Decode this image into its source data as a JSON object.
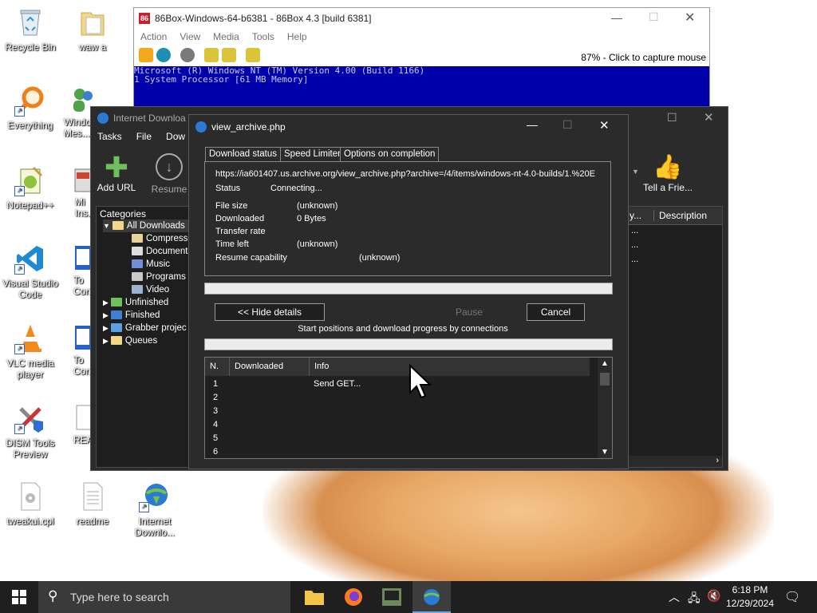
{
  "desktop": {
    "icons": [
      {
        "label": "Recycle Bin"
      },
      {
        "label": "waw a"
      },
      {
        "label": "Everything"
      },
      {
        "label": "Windows Mes..."
      },
      {
        "label": "Notepad++"
      },
      {
        "label": "Mi Ins..."
      },
      {
        "label": "Visual Studio Code"
      },
      {
        "label": "To Comm..."
      },
      {
        "label": "VLC media player"
      },
      {
        "label": "To Comm..."
      },
      {
        "label": "DISM Tools Preview"
      },
      {
        "label": "REA..."
      },
      {
        "label": "tweakui.cpl"
      },
      {
        "label": "readme"
      },
      {
        "label": "Internet Downlo..."
      }
    ]
  },
  "box86": {
    "title": "86Box-Windows-64-b6381 - 86Box 4.3 [build 6381]",
    "menu": [
      "Action",
      "View",
      "Media",
      "Tools",
      "Help"
    ],
    "status": "87% - Click to capture mouse",
    "screen_line1": "Microsoft (R) Windows NT (TM) Version 4.00 (Build 1166)",
    "screen_line2": "1 System Processor [61 MB Memory]"
  },
  "idm": {
    "title": "Internet Downloa",
    "menu": [
      "Tasks",
      "File",
      "Dow"
    ],
    "add_url": "Add URL",
    "resume": "Resume",
    "tell_friend": "Tell a Frie...",
    "categories_header": "Categories",
    "categories": [
      {
        "label": "All Downloads"
      },
      {
        "label": "Compresse"
      },
      {
        "label": "Documents"
      },
      {
        "label": "Music"
      },
      {
        "label": "Programs"
      },
      {
        "label": "Video"
      },
      {
        "label": "Unfinished"
      },
      {
        "label": "Finished"
      },
      {
        "label": "Grabber projec"
      },
      {
        "label": "Queues"
      }
    ],
    "col_partial": "y...",
    "col_description": "Description",
    "row_dots": [
      "...",
      "...",
      "..."
    ]
  },
  "dialog": {
    "title": "view_archive.php",
    "tabs": [
      "Download status",
      "Speed Limiter",
      "Options on completion"
    ],
    "url": "https://ia601407.us.archive.org/view_archive.php?archive=/4/items/windows-nt-4.0-builds/1.%20E",
    "status_label": "Status",
    "status_value": "Connecting...",
    "file_size_label": "File size",
    "file_size_value": "(unknown)",
    "downloaded_label": "Downloaded",
    "downloaded_value": "0 Bytes",
    "transfer_rate_label": "Transfer rate",
    "time_left_label": "Time left",
    "time_left_value": "(unknown)",
    "resume_label": "Resume capability",
    "resume_value": "(unknown)",
    "hide_details": "<< Hide details",
    "pause": "Pause",
    "cancel": "Cancel",
    "connections_caption": "Start positions and download progress by connections",
    "table_headers": [
      "N.",
      "Downloaded",
      "Info"
    ],
    "rows": [
      {
        "n": "1",
        "info": "Send GET..."
      },
      {
        "n": "2",
        "info": ""
      },
      {
        "n": "3",
        "info": ""
      },
      {
        "n": "4",
        "info": ""
      },
      {
        "n": "5",
        "info": ""
      },
      {
        "n": "6",
        "info": ""
      }
    ]
  },
  "taskbar": {
    "search_placeholder": "Type here to search",
    "time": "6:18 PM",
    "date": "12/29/2024"
  }
}
